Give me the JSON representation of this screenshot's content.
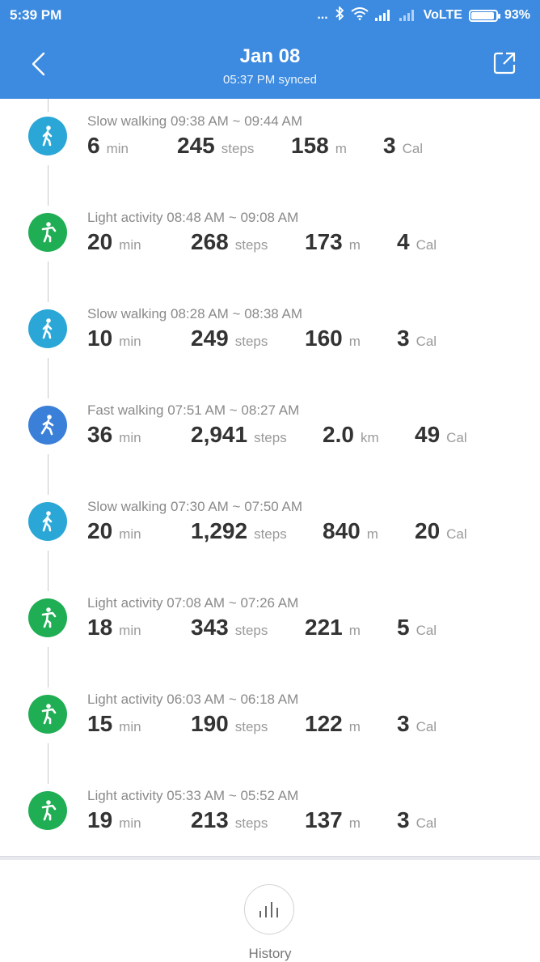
{
  "status_bar": {
    "time": "5:39 PM",
    "dots": "...",
    "network": "VoLTE",
    "battery": "93%",
    "battery_level": 0.93
  },
  "header": {
    "title": "Jan 08",
    "subtitle": "05:37 PM synced"
  },
  "colors": {
    "header_bg": "#3d8be0",
    "slow_walking": "#2aa7d6",
    "light_activity": "#1fae54",
    "fast_walking": "#3a7fd8"
  },
  "activities": [
    {
      "type": "slow",
      "title": "Slow walking 09:38 AM ~ 09:44 AM",
      "duration": "6",
      "duration_unit": "min",
      "steps": "245",
      "steps_unit": "steps",
      "distance": "158",
      "distance_unit": "m",
      "calories": "3",
      "calories_unit": "Cal"
    },
    {
      "type": "light",
      "title": "Light activity 08:48 AM ~ 09:08 AM",
      "duration": "20",
      "duration_unit": "min",
      "steps": "268",
      "steps_unit": "steps",
      "distance": "173",
      "distance_unit": "m",
      "calories": "4",
      "calories_unit": "Cal"
    },
    {
      "type": "slow",
      "title": "Slow walking 08:28 AM ~ 08:38 AM",
      "duration": "10",
      "duration_unit": "min",
      "steps": "249",
      "steps_unit": "steps",
      "distance": "160",
      "distance_unit": "m",
      "calories": "3",
      "calories_unit": "Cal"
    },
    {
      "type": "fast",
      "title": "Fast walking 07:51 AM ~ 08:27 AM",
      "duration": "36",
      "duration_unit": "min",
      "steps": "2,941",
      "steps_unit": "steps",
      "distance": "2.0",
      "distance_unit": "km",
      "calories": "49",
      "calories_unit": "Cal"
    },
    {
      "type": "slow",
      "title": "Slow walking 07:30 AM ~ 07:50 AM",
      "duration": "20",
      "duration_unit": "min",
      "steps": "1,292",
      "steps_unit": "steps",
      "distance": "840",
      "distance_unit": "m",
      "calories": "20",
      "calories_unit": "Cal"
    },
    {
      "type": "light",
      "title": "Light activity 07:08 AM ~ 07:26 AM",
      "duration": "18",
      "duration_unit": "min",
      "steps": "343",
      "steps_unit": "steps",
      "distance": "221",
      "distance_unit": "m",
      "calories": "5",
      "calories_unit": "Cal"
    },
    {
      "type": "light",
      "title": "Light activity 06:03 AM ~ 06:18 AM",
      "duration": "15",
      "duration_unit": "min",
      "steps": "190",
      "steps_unit": "steps",
      "distance": "122",
      "distance_unit": "m",
      "calories": "3",
      "calories_unit": "Cal"
    },
    {
      "type": "light",
      "title": "Light activity 05:33 AM ~ 05:52 AM",
      "duration": "19",
      "duration_unit": "min",
      "steps": "213",
      "steps_unit": "steps",
      "distance": "137",
      "distance_unit": "m",
      "calories": "3",
      "calories_unit": "Cal"
    }
  ],
  "footer": {
    "history_label": "History"
  }
}
